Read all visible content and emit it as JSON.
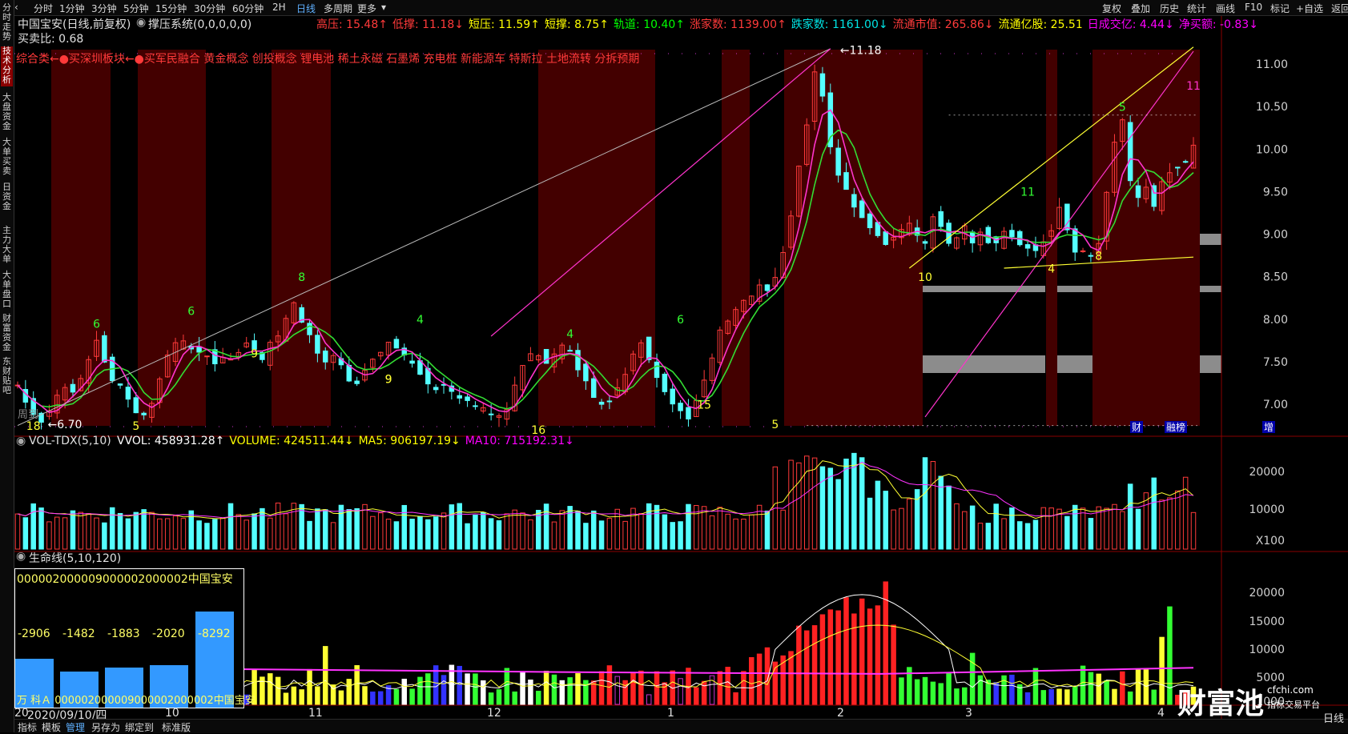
{
  "left_tabs": [
    "分时走势",
    "技术分析",
    "大盘资金",
    "大单买卖",
    "日资金",
    "主力大单",
    "大单盘口",
    "财富资金",
    "东财贴吧"
  ],
  "top_tabs": {
    "periods": [
      "分时",
      "1分钟",
      "3分钟",
      "5分钟",
      "15分钟",
      "30分钟",
      "60分钟",
      "2H",
      "日线",
      "多周期",
      "更多"
    ],
    "tools": [
      "复权",
      "叠加",
      "历史",
      "统计",
      "画线",
      "F10",
      "标记",
      "+自选",
      "返回"
    ]
  },
  "header": {
    "stock_title": "中国宝安(日线,前复权)",
    "indicator_title": "撑压系统(0,0,0,0,0)",
    "indicators": [
      {
        "label": "高压:",
        "value": "15.48",
        "arrow": "↑",
        "color": "#ff3a3a"
      },
      {
        "label": "低撑:",
        "value": "11.18",
        "arrow": "↓",
        "color": "#ff3a3a"
      },
      {
        "label": "短压:",
        "value": "11.59",
        "arrow": "↑",
        "color": "#ffff00"
      },
      {
        "label": "短撑:",
        "value": "8.75",
        "arrow": "↑",
        "color": "#ffff00"
      },
      {
        "label": "轨道:",
        "value": "10.40",
        "arrow": "↑",
        "color": "#00ff00"
      },
      {
        "label": "涨家数:",
        "value": "1139.00",
        "arrow": "↑",
        "color": "#ff3a3a"
      },
      {
        "label": "跌家数:",
        "value": "1161.00",
        "arrow": "↓",
        "color": "#00e5e5"
      },
      {
        "label": "流通市值:",
        "value": "265.86",
        "arrow": "↓",
        "color": "#ff3a3a"
      },
      {
        "label": "流通亿股:",
        "value": "25.51",
        "arrow": "",
        "color": "#ffff00"
      },
      {
        "label": "日成交亿:",
        "value": "4.44",
        "arrow": "↓",
        "color": "#ff00ff"
      },
      {
        "label": "净买额:",
        "value": "-0.83",
        "arrow": "↓",
        "color": "#ff00ff"
      }
    ],
    "buy_sell_ratio": "买卖比: 0.68",
    "concepts": "综合类←●买深圳板块←●买军民融合 黄金概念 创投概念 锂电池 稀土永磁 石墨烯 充电桩 新能源车 特斯拉 土地流转 分拆预期"
  },
  "main_chart": {
    "price_axis": [
      "11.00",
      "10.50",
      "10.00",
      "9.50",
      "9.00",
      "8.50",
      "8.00",
      "7.50",
      "7.00"
    ],
    "annotations": {
      "high": "11.18",
      "low": "6.70",
      "counts": [
        "18",
        "6",
        "5",
        "6",
        "8",
        "9",
        "9",
        "4",
        "9",
        "16",
        "4",
        "6",
        "15",
        "5",
        "10",
        "11",
        "4",
        "5",
        "8",
        "11"
      ],
      "bottom_watermark": "周到",
      "event_tags": [
        "财",
        "融榜",
        "增"
      ]
    }
  },
  "volume_panel": {
    "title": "VOL-TDX(5,10)",
    "values": [
      {
        "label": "VVOL:",
        "value": "458931.28",
        "arrow": "↑",
        "color": "#ffffff"
      },
      {
        "label": "VOLUME:",
        "value": "424511.44",
        "arrow": "↓",
        "color": "#ffff00"
      },
      {
        "label": "MA5:",
        "value": "906197.19",
        "arrow": "↓",
        "color": "#ffff00"
      },
      {
        "label": "MA10:",
        "value": "715192.31",
        "arrow": "↓",
        "color": "#ff00ff"
      }
    ],
    "axis": [
      "20000",
      "10000",
      "X100"
    ]
  },
  "life_panel": {
    "title": "生命线(5,10,120)",
    "axis": [
      "20000",
      "15000",
      "10000",
      "5000",
      "1000"
    ]
  },
  "popup": {
    "title": "000002000009000002000002中国宝安",
    "values": [
      "-2906",
      "-1482",
      "-1883",
      "-2020",
      "-8292"
    ],
    "labels": "万 科Ａ   000002000009000002000002中国宝安"
  },
  "time_axis": {
    "date_label": "2020/09/10/四",
    "year_prefix": "20",
    "months": [
      "10",
      "11",
      "12",
      "1",
      "2",
      "3",
      "4"
    ]
  },
  "bottom_tabs": [
    "指标",
    "模板",
    "管理",
    "另存为",
    "绑定到",
    "标准版"
  ],
  "watermark": {
    "brand": "财富池",
    "site": "cfchi.com",
    "tagline": "指标交易平台",
    "period_label": "日线"
  },
  "colors": {
    "up": "#ff3a3a",
    "down": "#54ffff",
    "ma_fast": "#ff33cc",
    "ma_slow": "#33dd33",
    "background": "#000000",
    "shade": "#5a0000"
  }
}
